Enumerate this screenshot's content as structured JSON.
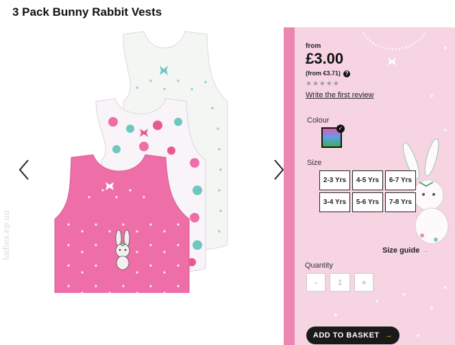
{
  "product": {
    "title": "3 Pack Bunny Rabbit Vests"
  },
  "gallery": {
    "prev_icon": "chevron-left-icon",
    "next_icon": "chevron-right-icon"
  },
  "pricing": {
    "from_label": "from",
    "price": "£3.00",
    "price_alt": "(from €3.71)",
    "help_icon": "help-circle-icon"
  },
  "reviews": {
    "stars": "★★★★★",
    "link": "Write the first review"
  },
  "colour": {
    "label": "Colour",
    "swatch_colors": [
      "#e05ab0",
      "#5aa0e6",
      "#3fae5a"
    ]
  },
  "size": {
    "label": "Size",
    "options": [
      "2-3 Yrs",
      "4-5 Yrs",
      "6-7 Yrs",
      "3-4 Yrs",
      "5-6 Yrs",
      "7-8 Yrs"
    ],
    "guide": "Size guide"
  },
  "quantity": {
    "label": "Quantity",
    "minus": "-",
    "value": "1",
    "plus": "+"
  },
  "basket": {
    "label": "ADD TO BASKET",
    "arrow": "→"
  },
  "watermark": "ladies.ep.ua",
  "colors": {
    "panel_bg": "#f6d4e2",
    "panel_stripe": "#ee86b2",
    "vest_pink": "#ee6fa8",
    "button_dark": "#1a1a1a"
  }
}
